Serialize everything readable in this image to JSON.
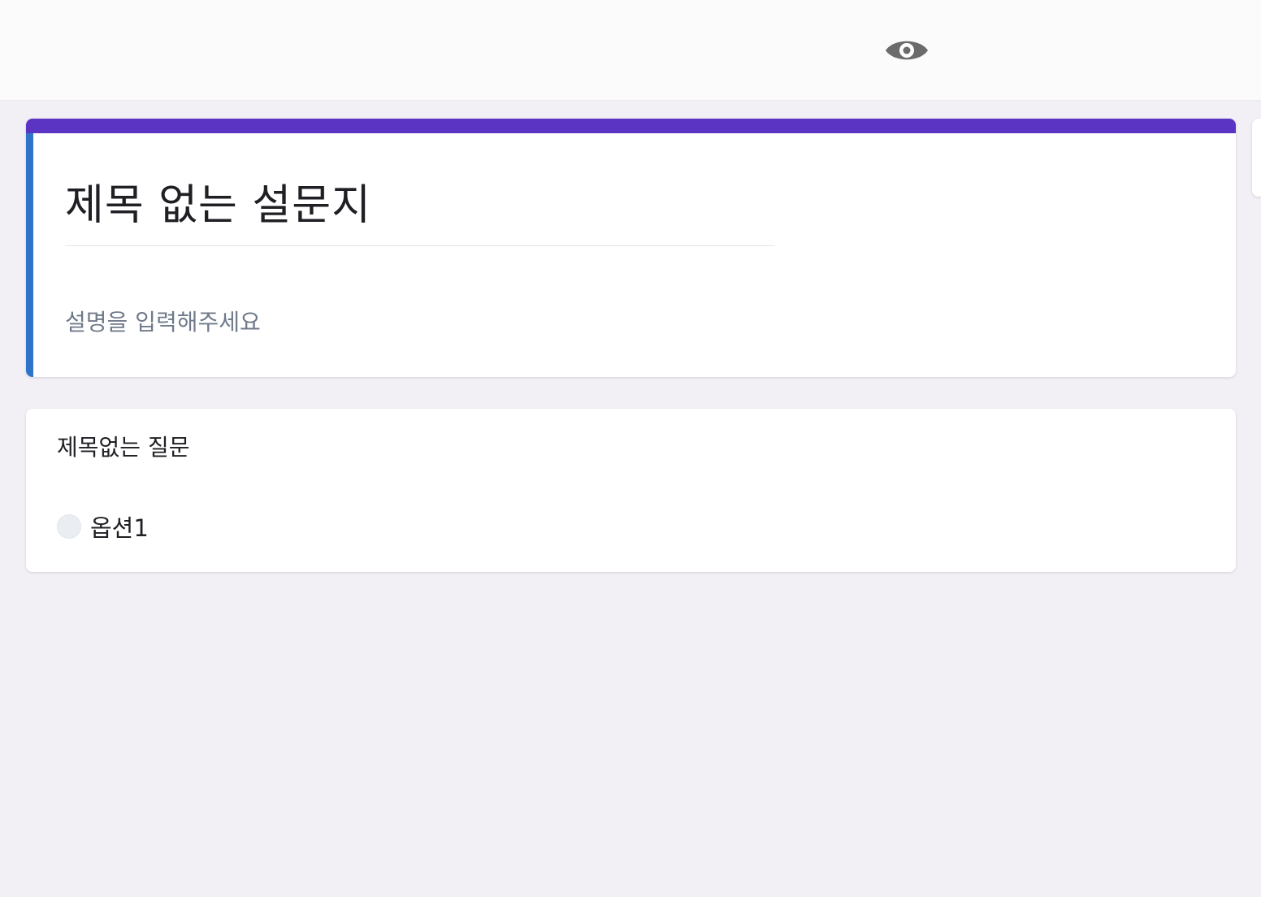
{
  "header": {
    "preview_icon": "eye-icon"
  },
  "form": {
    "title": "제목 없는 설문지",
    "description_placeholder": "설명을 입력해주세요",
    "accent_color": "#5b34c4",
    "section_color": "#2e74c9"
  },
  "question": {
    "title": "제목없는 질문",
    "options": [
      {
        "label": "옵션1"
      }
    ]
  }
}
